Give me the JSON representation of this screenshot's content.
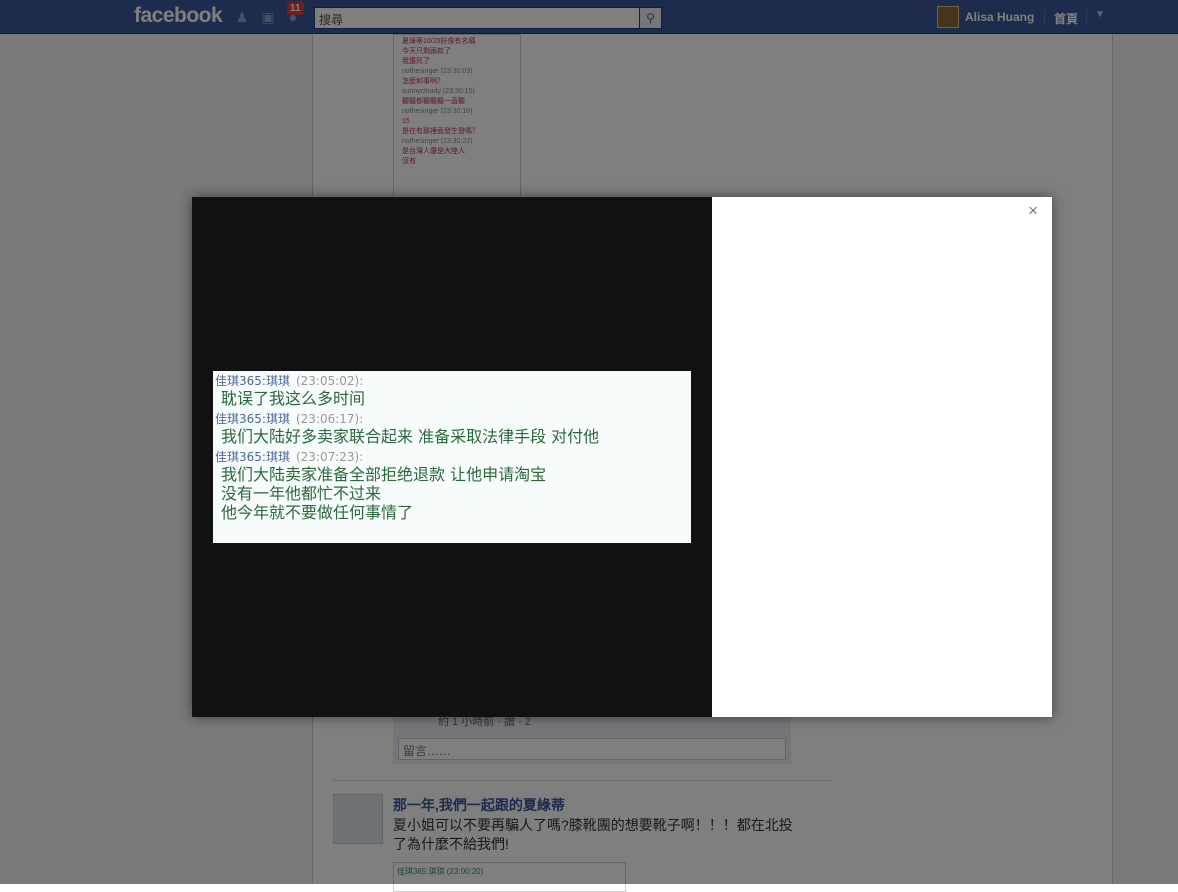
{
  "topbar": {
    "logo": "facebook",
    "notification_count": "11",
    "search_placeholder": "搜尋",
    "user_name": "Alisa Huang",
    "home_label": "首頁"
  },
  "background": {
    "chat_lines": [
      {
        "n": "",
        "m": "夏綠蒂10/25好像有名稱"
      },
      {
        "n": "",
        "m": "今天只剩兩款了"
      },
      {
        "n": "",
        "m": "我還死了"
      },
      {
        "n": "nothesinger (23:30:09)",
        "m": "怎麼如事啊？"
      },
      {
        "n": "sunnycloudy (23:30:15)",
        "m": "聽聽都聽聽聽一直聽"
      },
      {
        "n": "nothesinger (23:30:16)",
        "m": "15"
      },
      {
        "n": "",
        "m": "是在有那裡面發生發嗎？"
      },
      {
        "n": "nothesinger (23:30:22)",
        "m": "是台灣人還是大陸人"
      },
      {
        "n": "",
        "m": "沒有"
      }
    ],
    "post_meta": "約 1 小時前 · 讚 · 2",
    "comment_placeholder": "留言……",
    "post_title": "那一年,我們一起跟的夏綠蒂",
    "post_text": "夏小姐可以不要再騙人了嗎?膝靴團的想要靴子啊！！！都在北投了為什麼不給我們!",
    "post_image_caption": "佳琪365:琪琪 (23:00:20)"
  },
  "modal": {
    "close_label": "×",
    "photo_messages": [
      {
        "sender": "佳琪365:琪琪",
        "time": "(23:05:02):",
        "lines": [
          "耽误了我这么多时间"
        ]
      },
      {
        "sender": "佳琪365:琪琪",
        "time": "(23:06:17):",
        "lines": [
          "我们大陆好多卖家联合起来  准备采取法律手段  对付他"
        ]
      },
      {
        "sender": "佳琪365:琪琪",
        "time": "(23:07:23):",
        "lines": [
          "我们大陆卖家准备全部拒绝退款  让他申请淘宝",
          "没有一年他都忙不过来",
          "他今年就不要做任何事情了"
        ]
      }
    ]
  }
}
